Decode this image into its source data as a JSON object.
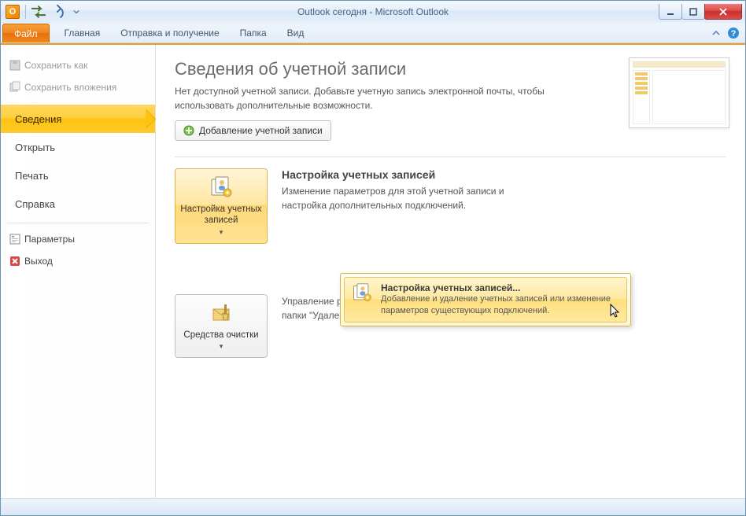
{
  "window": {
    "title": "Outlook сегодня  -  Microsoft Outlook"
  },
  "ribbon": {
    "file": "Файл",
    "tabs": [
      "Главная",
      "Отправка и получение",
      "Папка",
      "Вид"
    ]
  },
  "nav": {
    "save_as": "Сохранить как",
    "save_attachments": "Сохранить вложения",
    "info": "Сведения",
    "open": "Открыть",
    "print": "Печать",
    "help": "Справка",
    "options": "Параметры",
    "exit": "Выход"
  },
  "page": {
    "title": "Сведения об учетной записи",
    "desc": "Нет доступной учетной записи. Добавьте учетную запись электронной почты, чтобы использовать дополнительные возможности.",
    "add_account": "Добавление учетной записи",
    "sect1": {
      "button": "Настройка учетных записей",
      "title": "Настройка учетных записей",
      "desc": "Изменение параметров для этой учетной записи и настройка дополнительных подключений."
    },
    "sect2": {
      "button": "Средства очистки",
      "desc": "Управление размером почтового ящика, включая очистку папки \"Удаленные\" и архивацию."
    },
    "dropdown": {
      "title": "Настройка учетных записей...",
      "desc": "Добавление и удаление учетных записей или изменение параметров существующих подключений."
    }
  }
}
